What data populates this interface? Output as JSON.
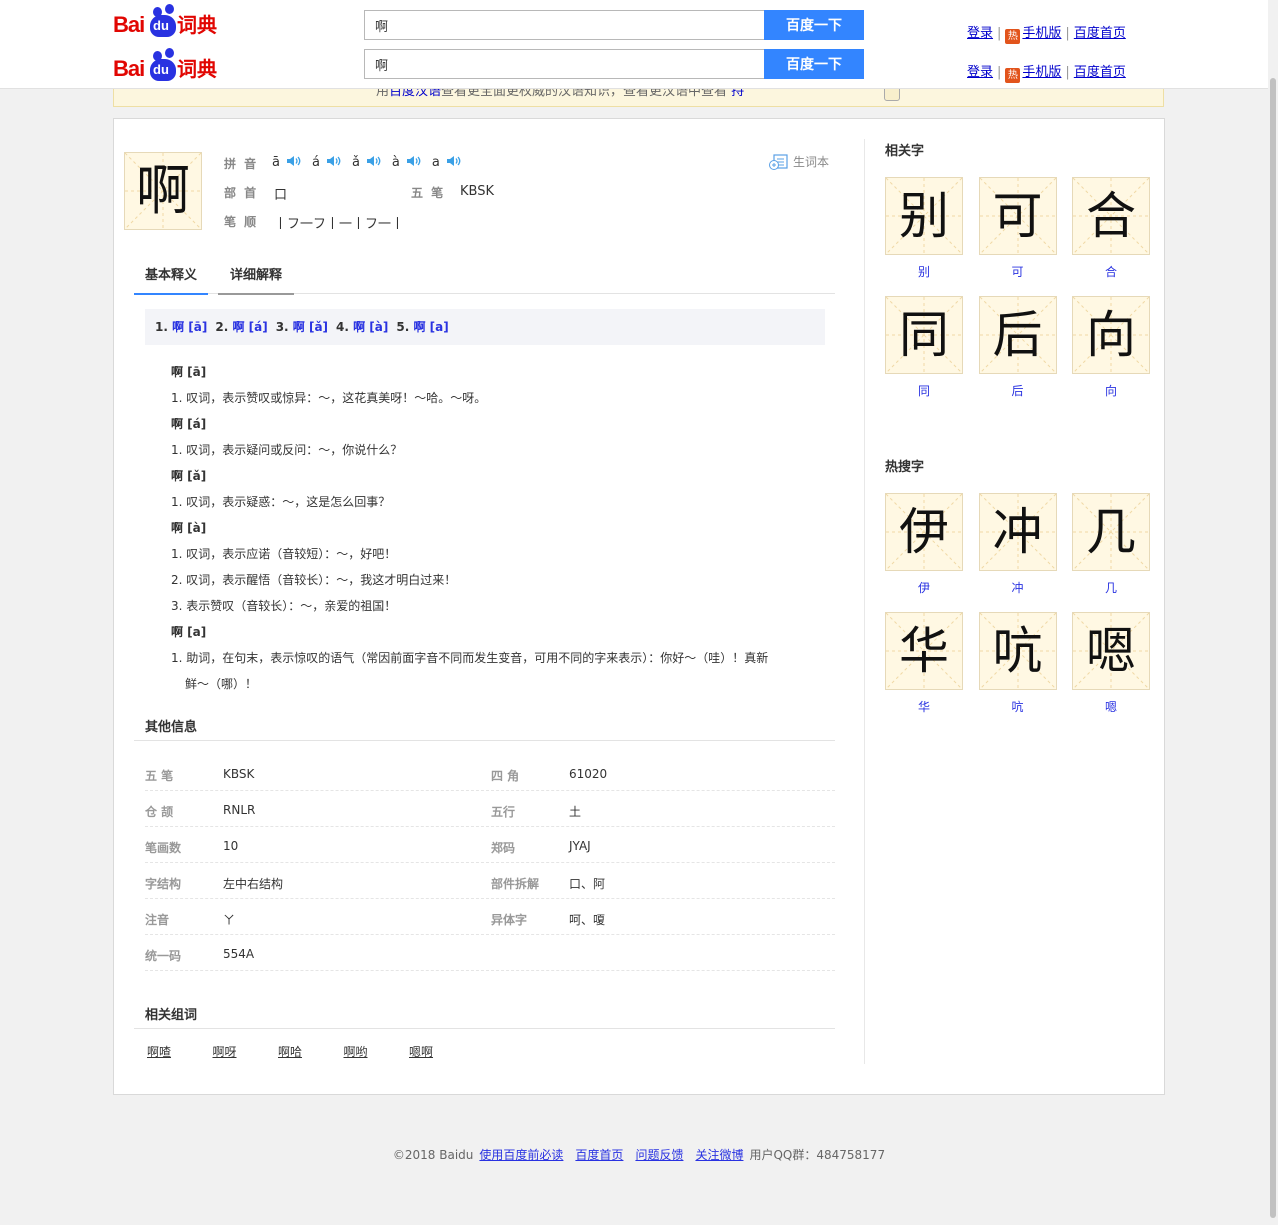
{
  "header": {
    "logo_text": "Bai",
    "logo_paw_text": "du",
    "logo_cd": "词典",
    "search_value": "啊",
    "search_button": "百度一下",
    "links": {
      "login": "登录",
      "mobile": "手机版",
      "home": "百度首页"
    },
    "hot_badge": "热"
  },
  "notice": {
    "pre": "用",
    "link": "百度汉语",
    "post": "查看更全面更权威的汉语知识，查看更汉语中查看",
    "link2": "持"
  },
  "entry": {
    "char": "啊",
    "labels": {
      "pinyin": "拼 音",
      "radical": "部 首",
      "wubi": "五 笔",
      "strokes": "笔 顺"
    },
    "pinyin": [
      "ā",
      "á",
      "ǎ",
      "à",
      "a"
    ],
    "radical": "口",
    "wubi": "KBSK",
    "stroke_order": "丨フ一フ丨一丨フ一丨",
    "vocab_button": "生词本"
  },
  "tabs": [
    "基本释义",
    "详细解释"
  ],
  "pinyin_bar": [
    {
      "num": "1.",
      "text": "啊 [ā]"
    },
    {
      "num": "2.",
      "text": "啊 [á]"
    },
    {
      "num": "3.",
      "text": "啊 [ǎ]"
    },
    {
      "num": "4.",
      "text": "啊 [à]"
    },
    {
      "num": "5.",
      "text": "啊 [a]"
    }
  ],
  "definitions": [
    {
      "head": "啊 [ā]",
      "items": [
        "1. 叹词，表示赞叹或惊异：～，这花真美呀！～哈。～呀。"
      ]
    },
    {
      "head": "啊 [á]",
      "items": [
        "1. 叹词，表示疑问或反问：～，你说什么？"
      ]
    },
    {
      "head": "啊 [ǎ]",
      "items": [
        "1. 叹词，表示疑惑：～，这是怎么回事？"
      ]
    },
    {
      "head": "啊 [à]",
      "items": [
        "1. 叹词，表示应诺（音较短）：～，好吧！",
        "2. 叹词，表示醒悟（音较长）：～，我这才明白过来！",
        "3. 表示赞叹（音较长）：～，亲爱的祖国！"
      ]
    },
    {
      "head": "啊 [a]",
      "items": [
        "1. 助词，在句末，表示惊叹的语气（常因前面字音不同而发生变音，可用不同的字来表示）：你好～（哇）！真新",
        "鲜～（哪）！"
      ]
    }
  ],
  "other_info": {
    "title": "其他信息",
    "rows": [
      [
        {
          "k": "五 笔",
          "v": "KBSK"
        },
        {
          "k": "四 角",
          "v": "61020"
        }
      ],
      [
        {
          "k": "仓 颉",
          "v": "RNLR"
        },
        {
          "k": "五行",
          "v": "土"
        }
      ],
      [
        {
          "k": "笔画数",
          "v": "10"
        },
        {
          "k": "郑码",
          "v": "JYAJ"
        }
      ],
      [
        {
          "k": "字结构",
          "v": "左中右结构"
        },
        {
          "k": "部件拆解",
          "v": "口、阿"
        }
      ],
      [
        {
          "k": "注音",
          "v": "ㄚ"
        },
        {
          "k": "异体字",
          "v": "呵、嗄"
        }
      ],
      [
        {
          "k": "统一码",
          "v": "554A"
        }
      ]
    ]
  },
  "related_words": {
    "title": "相关组词",
    "words": [
      "啊喳",
      "啊呀",
      "啊哈",
      "啊哟",
      "嗯啊"
    ]
  },
  "related_chars": {
    "title": "相关字",
    "chars": [
      "别",
      "可",
      "合",
      "同",
      "后",
      "向"
    ]
  },
  "hot_chars": {
    "title": "热搜字",
    "chars": [
      "伊",
      "冲",
      "几",
      "华",
      "吭",
      "嗯"
    ]
  },
  "footer": {
    "copyright": "©2018 Baidu",
    "links": [
      "使用百度前必读",
      "百度首页",
      "问题反馈",
      "关注微博"
    ],
    "qq": "用户QQ群：484758177"
  },
  "colors": {
    "accent": "#3385ff",
    "brand_red": "#e10602",
    "brand_blue": "#2932e1",
    "tile_bg": "#fff8e3"
  }
}
